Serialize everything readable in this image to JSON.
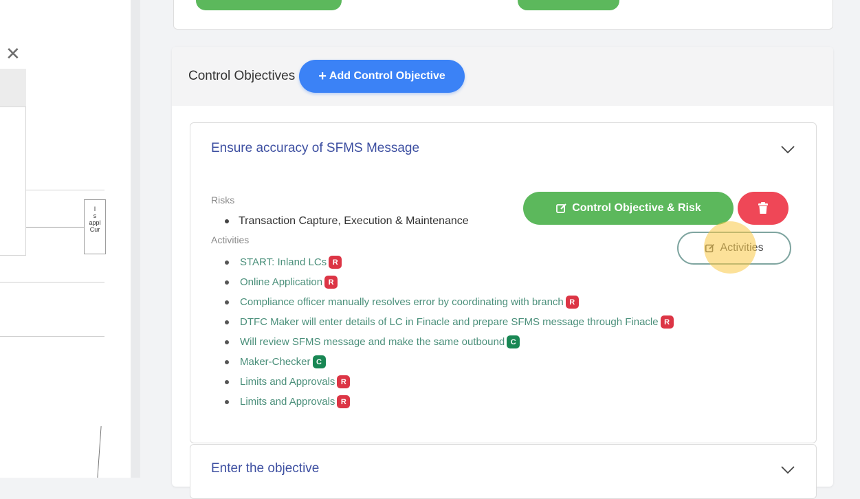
{
  "left_panel": {
    "close_icon": "close-icon",
    "diagram_box_lines": [
      "I",
      "s",
      "appl",
      "Cur"
    ]
  },
  "section": {
    "title": "Control Objectives",
    "add_button": {
      "icon": "plus-icon",
      "label": "Add Control Objective"
    }
  },
  "objectives": [
    {
      "title": "Ensure accuracy of SFMS Message",
      "expanded": true,
      "risks_label": "Risks",
      "risks": [
        "Transaction Capture, Execution & Maintenance"
      ],
      "activities_label": "Activities",
      "activities": [
        {
          "text": "START: Inland LCs",
          "badge": "R"
        },
        {
          "text": "Online Application",
          "badge": "R"
        },
        {
          "text": "Compliance officer manually resolves error by coordinating with branch",
          "badge": "R"
        },
        {
          "text": "DTFC Maker will enter details of LC in Finacle and prepare SFMS message through Finacle",
          "badge": "R"
        },
        {
          "text": "Will review SFMS message and make the same outbound",
          "badge": "C"
        },
        {
          "text": "Maker-Checker",
          "badge": "C"
        },
        {
          "text": "Limits and Approvals",
          "badge": "R"
        },
        {
          "text": "Limits and Approvals",
          "badge": "R"
        }
      ],
      "buttons": {
        "edit_objective": "Control Objective & Risk",
        "delete_icon": "trash-icon",
        "edit_activities": "Activities"
      }
    },
    {
      "title": "Enter the objective",
      "expanded": false
    }
  ],
  "colors": {
    "primary": "#3b82f6",
    "success": "#5cb85c",
    "danger": "#ef4757",
    "risk_badge": "#dc3545",
    "control_badge": "#198754",
    "objective_title": "#3d4fa1"
  }
}
